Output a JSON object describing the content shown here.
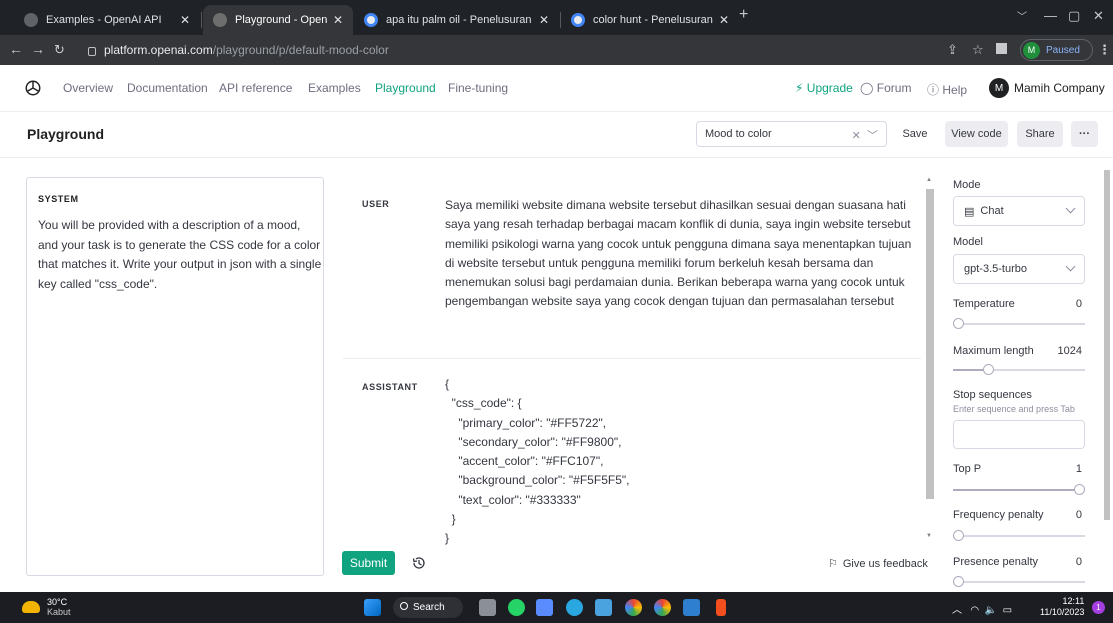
{
  "browser": {
    "tabs": [
      {
        "title": "Examples - OpenAI API",
        "favicon_color": "#5f6368",
        "active": false
      },
      {
        "title": "Playground - OpenAI API",
        "favicon_color": "#5f6368",
        "active": true
      },
      {
        "title": "apa itu palm oil - Penelusuran G",
        "favicon_color": "#4285f4",
        "active": false
      },
      {
        "title": "color hunt - Penelusuran Google",
        "favicon_color": "#4285f4",
        "active": false
      }
    ],
    "new_tab": "+",
    "url_host": "platform.openai.com",
    "url_path": "/playground/p/default-mood-color",
    "profile_initial": "M",
    "profile_status": "Paused"
  },
  "nav": {
    "links": [
      "Overview",
      "Documentation",
      "API reference",
      "Examples",
      "Playground",
      "Fine-tuning"
    ],
    "active": "Playground",
    "upgrade": "Upgrade",
    "forum": "Forum",
    "help": "Help",
    "org_initial": "M",
    "org_name": "Mamih Company"
  },
  "header": {
    "title": "Playground",
    "preset": "Mood to color",
    "save": "Save",
    "view_code": "View code",
    "share": "Share",
    "more": "···"
  },
  "system": {
    "label": "SYSTEM",
    "text": "You will be provided with a description of a mood, and your task is to generate the CSS code for a color that matches it. Write your output in json with a single key called \"css_code\"."
  },
  "messages": {
    "user_role": "USER",
    "user_text": "Saya memiliki website dimana website tersebut dihasilkan sesuai dengan suasana hati saya yang resah terhadap berbagai macam konflik di dunia, saya ingin website tersebut memiliki psikologi warna yang cocok untuk pengguna dimana saya menentapkan tujuan di website tersebut untuk pengguna memiliki forum berkeluh kesah bersama dan menemukan solusi bagi perdamaian dunia. Berikan beberapa warna yang cocok untuk pengembangan website saya yang cocok dengan tujuan dan permasalahan tersebut",
    "assistant_role": "ASSISTANT",
    "assistant_text": "{\n  \"css_code\": {\n    \"primary_color\": \"#FF5722\",\n    \"secondary_color\": \"#FF9800\",\n    \"accent_color\": \"#FFC107\",\n    \"background_color\": \"#F5F5F5\",\n    \"text_color\": \"#333333\"\n  }\n}"
  },
  "actions": {
    "submit": "Submit",
    "feedback": "Give us feedback"
  },
  "settings": {
    "mode_label": "Mode",
    "mode_value": "Chat",
    "model_label": "Model",
    "model_value": "gpt-3.5-turbo",
    "temperature_label": "Temperature",
    "temperature_value": "0",
    "temperature_fraction": 0,
    "max_length_label": "Maximum length",
    "max_length_value": "1024",
    "max_length_fraction": 0.25,
    "stop_label": "Stop sequences",
    "stop_hint": "Enter sequence and press Tab",
    "top_p_label": "Top P",
    "top_p_value": "1",
    "top_p_fraction": 1,
    "freq_label": "Frequency penalty",
    "freq_value": "0",
    "freq_fraction": 0,
    "presence_label": "Presence penalty",
    "presence_value": "0",
    "presence_fraction": 0
  },
  "taskbar": {
    "temp": "30°C",
    "weather": "Kabut",
    "search": "Search",
    "time": "12:11",
    "date": "11/10/2023",
    "notifications": "1"
  },
  "colors": {
    "accent": "#10a37f",
    "chrome_dark": "#1f2327",
    "taskbar": "#1c1d22"
  }
}
